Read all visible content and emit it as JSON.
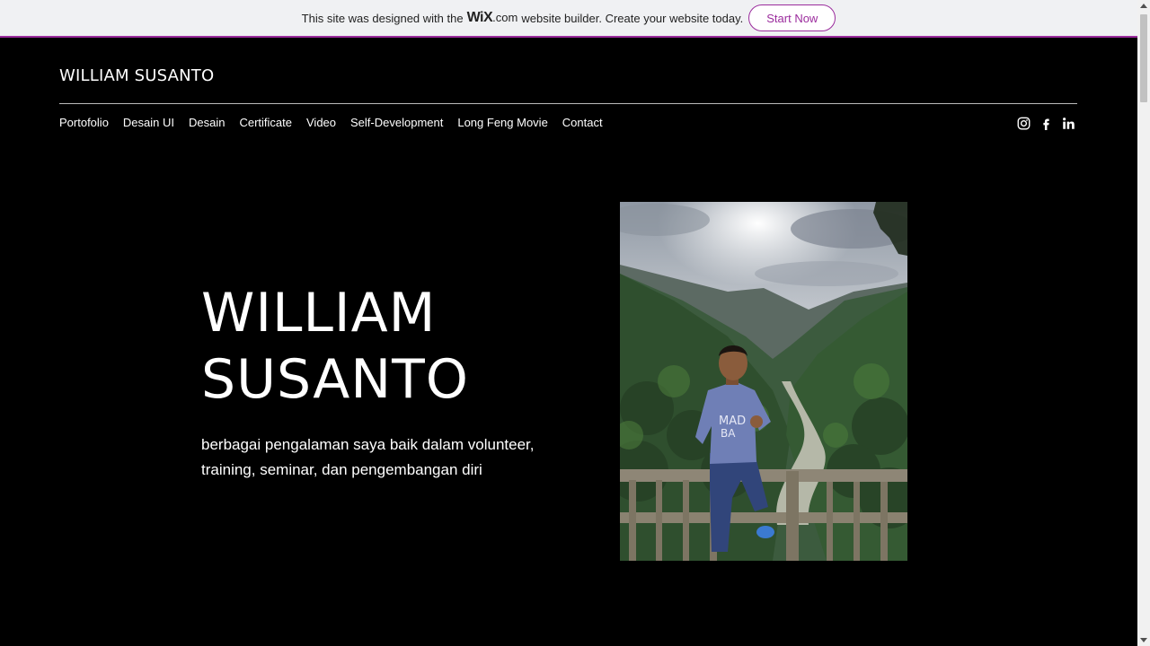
{
  "banner": {
    "text_before": "This site was designed with the",
    "wix": "WiX",
    "dotcom": ".com",
    "text_after": "website builder. Create your website today.",
    "button": "Start Now",
    "accent_color": "#9b2c9d"
  },
  "header": {
    "site_title": "WILLIAM SUSANTO",
    "nav": [
      "Portofolio",
      "Desain UI",
      "Desain",
      "Certificate",
      "Video",
      "Self-Development",
      "Long Feng Movie",
      "Contact"
    ],
    "social_icons": [
      "instagram-icon",
      "facebook-icon",
      "linkedin-icon"
    ]
  },
  "hero": {
    "name_line1": "WILLIAM",
    "name_line2": "SUSANTO",
    "description": "berbagai pengalaman saya baik dalam volunteer, training, seminar, dan pengembangan diri",
    "photo": "profile-photo"
  }
}
